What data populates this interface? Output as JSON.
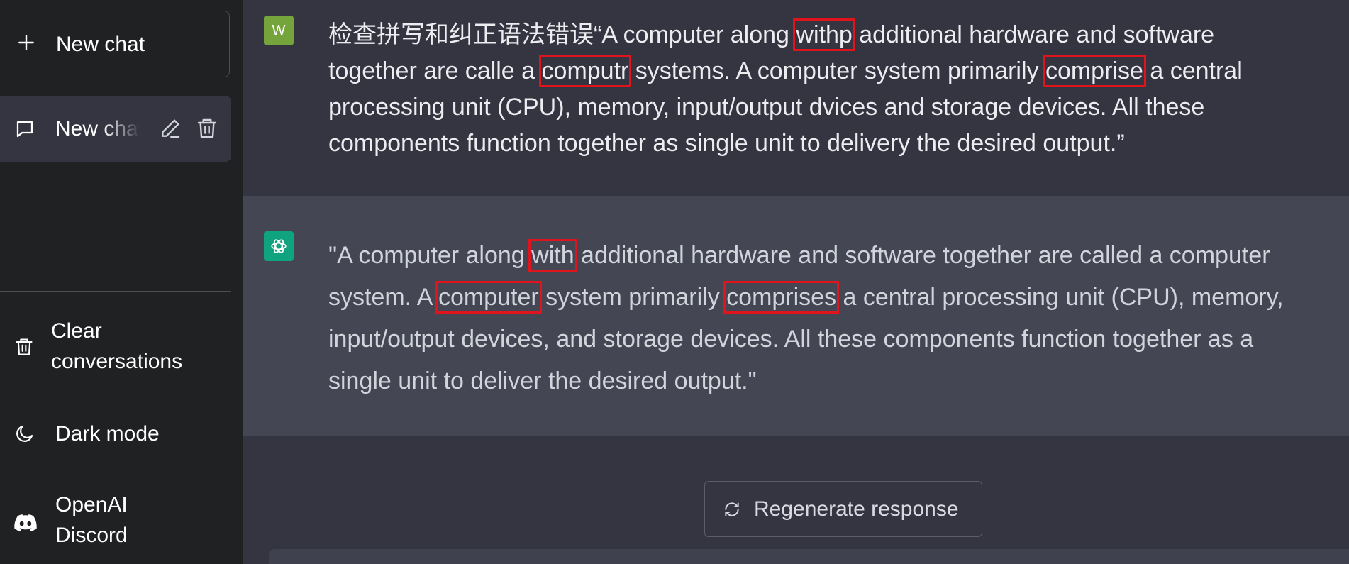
{
  "sidebar": {
    "new_chat_label": "New chat",
    "conversations": [
      {
        "title": "New chat"
      }
    ],
    "menu": {
      "clear_conversations": "Clear conversations",
      "dark_mode": "Dark mode",
      "discord": "OpenAI Discord"
    }
  },
  "messages": {
    "user": {
      "avatar_letter": "W",
      "lines": [
        [
          "检查拼写和纠正语法错误“A computer along ",
          "withp",
          " additional hardware and software"
        ],
        [
          "together are calle a ",
          "computr",
          " systems. A computer system primarily ",
          "comprise",
          " a central"
        ],
        [
          "processing unit (CPU), memory, input/output dvices and storage devices. All these"
        ],
        [
          "components function together as single unit to delivery the desired output.”"
        ]
      ]
    },
    "assistant": {
      "lines": [
        [
          "\"A computer along ",
          "with",
          " additional hardware and software together are called a computer"
        ],
        [
          "system. A ",
          "computer",
          " system primarily ",
          "comprises",
          " a central processing unit (CPU), memory,"
        ],
        [
          "input/output devices, and storage devices. All these components function together as a"
        ],
        [
          "single unit to deliver the desired output.\""
        ]
      ]
    }
  },
  "regenerate_label": "Regenerate response",
  "colors": {
    "sidebar_bg": "#202123",
    "main_bg": "#343541",
    "assistant_bg": "#444654",
    "user_avatar": "#75a33c",
    "bot_avatar": "#10a37f",
    "highlight": "#e0141c"
  }
}
